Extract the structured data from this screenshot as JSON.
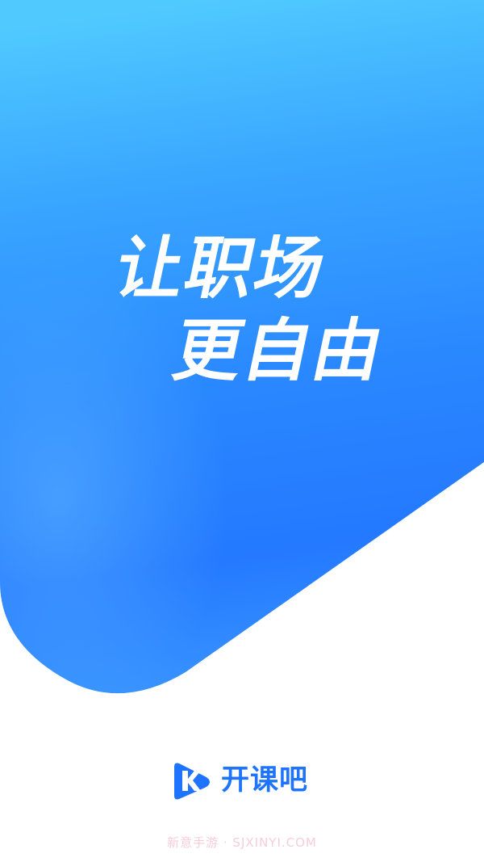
{
  "slogan": {
    "line1": "让职场",
    "line2": "更自由"
  },
  "brand": {
    "logo_icon": "kaikeba-play-k-icon",
    "name": "开课吧",
    "color": "#1f74ff"
  },
  "watermark": {
    "text": "新意手游 · SJXINYI.COM"
  },
  "colors": {
    "gradient_top": "#4fc8ff",
    "gradient_mid": "#2a86ff",
    "gradient_bottom": "#1f78ff",
    "background": "#ffffff"
  }
}
